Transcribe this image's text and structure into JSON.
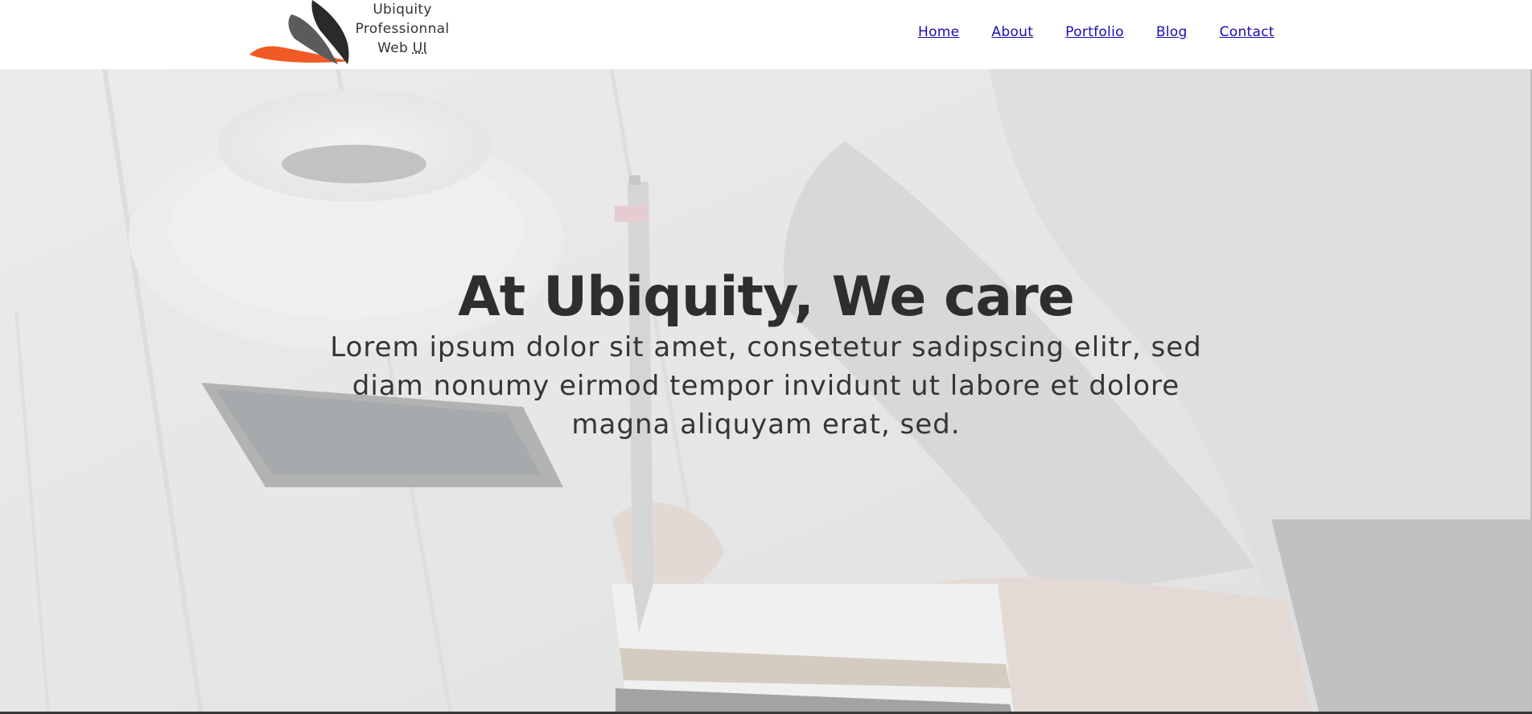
{
  "brand": {
    "line1": "Ubiquity",
    "line2": "Professionnal",
    "line3a": "Web ",
    "line3b": "UI",
    "colors": {
      "orange": "#f05a24",
      "dark": "#2a2a2a",
      "grey": "#5b5b5b"
    }
  },
  "nav": {
    "items": [
      {
        "label": "Home"
      },
      {
        "label": "About"
      },
      {
        "label": "Portfolio"
      },
      {
        "label": "Blog"
      },
      {
        "label": "Contact"
      }
    ],
    "link_color": "#1a0dab"
  },
  "hero": {
    "title": "At Ubiquity, We care",
    "subtitle": "Lorem ipsum dolor sit amet, consetetur sadipscing elitr, sed diam nonumy eirmod tempor invidunt ut labore et dolore magna aliquyam erat, sed."
  }
}
